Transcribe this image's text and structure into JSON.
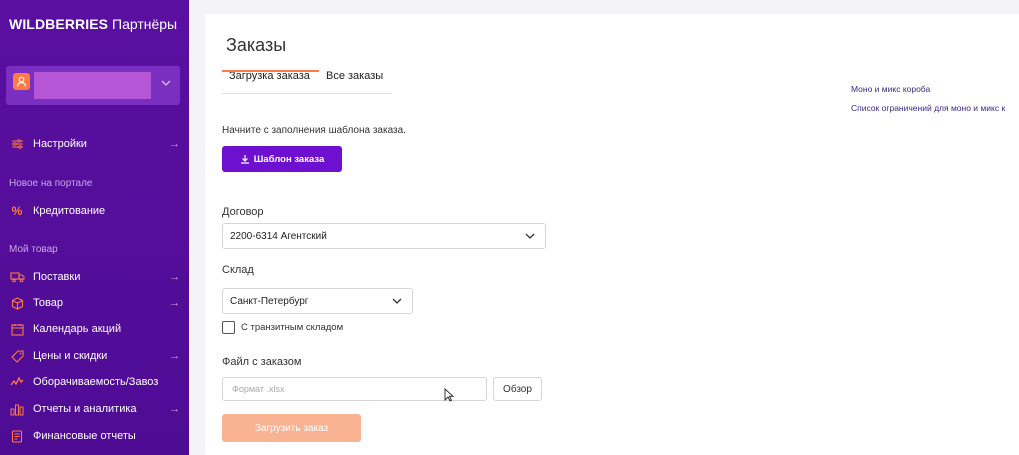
{
  "brand": {
    "bold": "WILDBERRIES",
    "light": "Партнёры"
  },
  "sidebar": {
    "items": [
      {
        "label": "Настройки",
        "icon": "sliders-icon",
        "arrow": "→"
      },
      {
        "label": "Кредитование",
        "icon": "percent-icon",
        "arrow": ""
      },
      {
        "label": "Поставки",
        "icon": "truck-icon",
        "arrow": "→"
      },
      {
        "label": "Товар",
        "icon": "box-icon",
        "arrow": "→"
      },
      {
        "label": "Календарь акций",
        "icon": "calendar-icon",
        "arrow": ""
      },
      {
        "label": "Цены и скидки",
        "icon": "tag-icon",
        "arrow": "→"
      },
      {
        "label": "Оборачиваемость/Завоз",
        "icon": "trend-icon",
        "arrow": ""
      },
      {
        "label": "Отчеты и аналитика",
        "icon": "bar-chart-icon",
        "arrow": "→"
      },
      {
        "label": "Финансовые отчеты",
        "icon": "document-icon",
        "arrow": ""
      }
    ],
    "sections": {
      "new": "Новое на портале",
      "my_goods": "Мой товар"
    }
  },
  "main": {
    "title": "Заказы",
    "tabs": [
      {
        "label": "Загрузка заказа"
      },
      {
        "label": "Все заказы"
      }
    ],
    "hint": "Начните с заполнения шаблона заказа.",
    "template_button": "Шаблон заказа",
    "contract_label": "Договор",
    "contract_value": "2200-6314 Агентский",
    "warehouse_label": "Склад",
    "warehouse_value": "Санкт-Петербург",
    "transit_checkbox": "С транзитным складом",
    "file_label": "Файл с заказом",
    "file_placeholder": "Формат .xlsx",
    "browse_button": "Обзор",
    "upload_button": "Загрузить заказ",
    "links": [
      "Моно и микс короба",
      "Список ограничений для моно и микс к"
    ]
  },
  "colors": {
    "sidebar": "#5a0fa0",
    "accent": "#ff7a45",
    "primary_button": "#6d10cf",
    "disabled_button": "#f9b392"
  }
}
